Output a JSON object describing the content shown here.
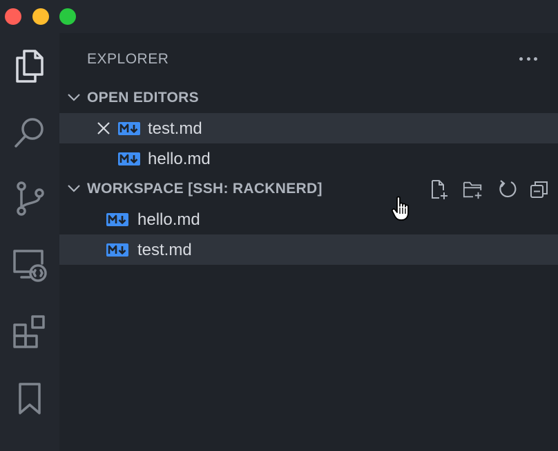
{
  "window": {
    "traffic_lights": {
      "close": "#fe5f57",
      "minimize": "#febc2e",
      "zoom": "#28c840"
    }
  },
  "activity_bar": {
    "icons": [
      "explorer-icon",
      "search-icon",
      "source-control-icon",
      "remote-explorer-icon",
      "extensions-icon",
      "bookmark-icon"
    ],
    "active": "explorer-icon"
  },
  "explorer": {
    "title": "EXPLORER",
    "open_editors": {
      "title": "OPEN EDITORS",
      "items": [
        {
          "name": "test.md",
          "active": true
        },
        {
          "name": "hello.md",
          "active": false
        }
      ]
    },
    "workspace": {
      "title": "WORKSPACE [SSH: RACKNERD]",
      "actions": [
        "new-file-icon",
        "new-folder-icon",
        "refresh-icon",
        "collapse-all-icon"
      ],
      "files": [
        {
          "name": "hello.md",
          "selected": false
        },
        {
          "name": "test.md",
          "selected": true
        }
      ]
    },
    "colors": {
      "markdown_icon": "#3f8ef3",
      "selected_row": "#2f343c"
    }
  }
}
